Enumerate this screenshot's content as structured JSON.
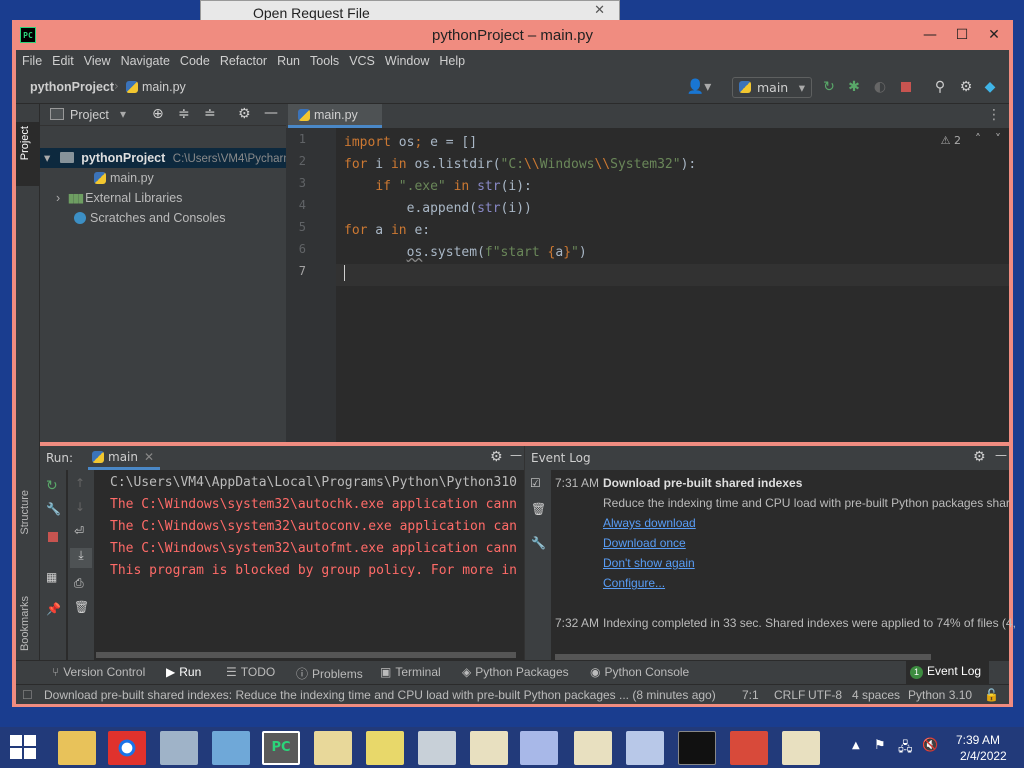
{
  "background_window": {
    "title": "Open Request File"
  },
  "window": {
    "title": "pythonProject – main.py",
    "logo": "PC"
  },
  "menu": [
    "File",
    "Edit",
    "View",
    "Navigate",
    "Code",
    "Refactor",
    "Run",
    "Tools",
    "VCS",
    "Window",
    "Help"
  ],
  "breadcrumb": {
    "project": "pythonProject",
    "file": "main.py"
  },
  "toolbar": {
    "branch": "main"
  },
  "left_stripe": {
    "project": "Project",
    "structure": "Structure",
    "bookmarks": "Bookmarks"
  },
  "project_panel": {
    "title": "Project",
    "tree": [
      {
        "label": "pythonProject",
        "path": "C:\\Users\\VM4\\Pycharm"
      },
      {
        "label": "main.py"
      },
      {
        "label": "External Libraries"
      },
      {
        "label": "Scratches and Consoles"
      }
    ]
  },
  "editor": {
    "tab": "main.py",
    "warnings": "2",
    "line_numbers": [
      "1",
      "2",
      "3",
      "4",
      "5",
      "6",
      "7"
    ]
  },
  "run_panel": {
    "label": "Run:",
    "tab": "main",
    "output": [
      "C:\\Users\\VM4\\AppData\\Local\\Programs\\Python\\Python310",
      "The C:\\Windows\\system32\\autochk.exe application cann",
      "The C:\\Windows\\system32\\autoconv.exe application can",
      "The C:\\Windows\\system32\\autofmt.exe application cann",
      "This program is blocked by group policy. For more in"
    ]
  },
  "event_log": {
    "title": "Event Log",
    "events": [
      {
        "time": "7:31 AM",
        "title": "Download pre-built shared indexes",
        "body": "Reduce the indexing time and CPU load with pre-built Python packages shar",
        "links": [
          "Always download",
          "Download once",
          "Don't show again",
          "Configure..."
        ]
      },
      {
        "time": "7:32 AM",
        "body": "Indexing completed in 33 sec. Shared indexes were applied to 74% of files (4,"
      }
    ]
  },
  "tool_tabs": [
    "Version Control",
    "Run",
    "TODO",
    "Problems",
    "Terminal",
    "Python Packages",
    "Python Console"
  ],
  "event_log_tab": {
    "badge": "1",
    "label": "Event Log"
  },
  "status_bar": {
    "message": "Download pre-built shared indexes: Reduce the indexing time and CPU load with pre-built Python packages ... (8 minutes ago)",
    "position": "7:1",
    "line_sep": "CRLF",
    "encoding": "UTF-8",
    "indent": "4 spaces",
    "interpreter": "Python 3.10"
  },
  "taskbar": {
    "time": "7:39 AM",
    "date": "2/4/2022"
  },
  "colors": {
    "keyword": "#cc7832",
    "string": "#6a8759",
    "error": "#ff6b68",
    "frame": "#f08c80",
    "link": "#589df6"
  }
}
